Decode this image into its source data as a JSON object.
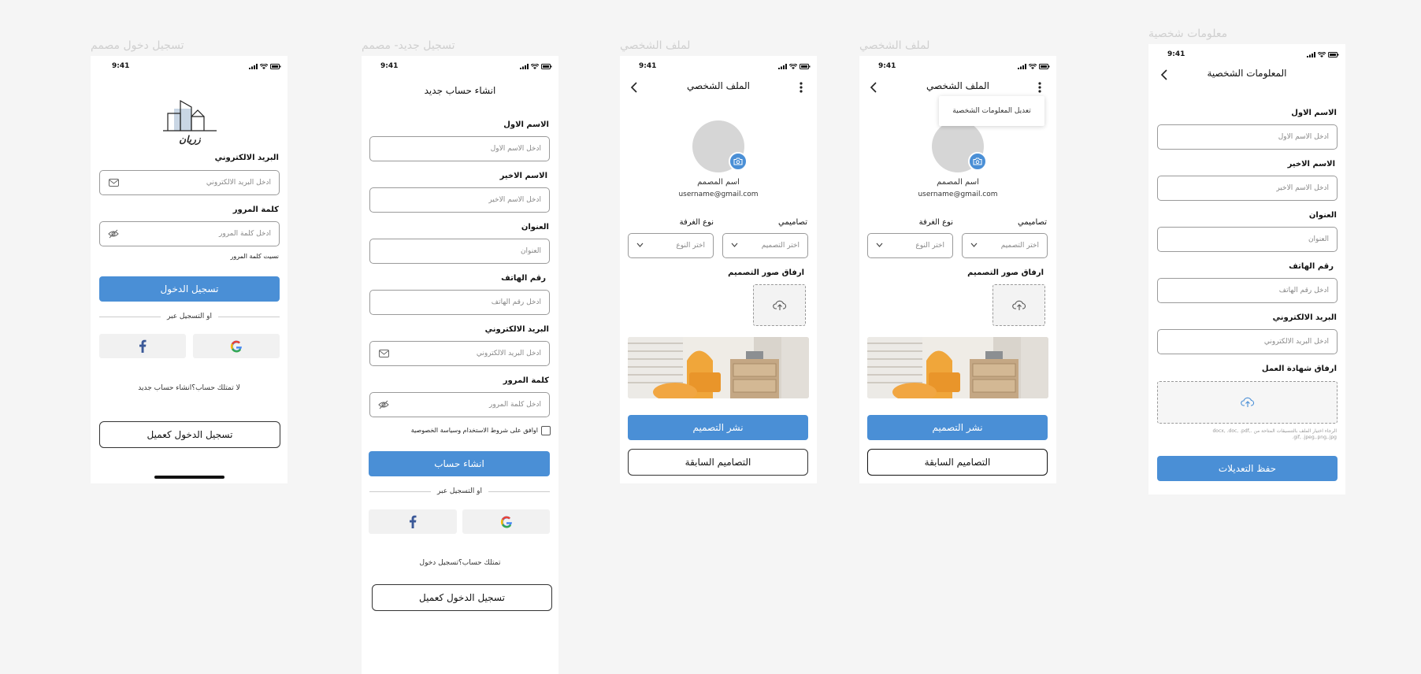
{
  "status_time": "9:41",
  "frames": {
    "login": {
      "title": "تسجيل دخول مصمم",
      "logo_text": "زريان",
      "email_label": "البريد الالكتروني",
      "email_placeholder": "ادخل البريد الالكتروني",
      "password_label": "كلمة المرور",
      "password_placeholder": "ادخل كلمة المرور",
      "forgot_password": "نسيت كلمة المرور",
      "login_button": "تسجيل الدخول",
      "or_register_with": "او التسجيل عبر",
      "no_account": "لا تمتلك حساب؟انشاء حساب جديد",
      "client_login_button": "تسجيل الدخول كعميل"
    },
    "signup": {
      "title": "تسجيل جديد- مصمم",
      "header": "انشاء حساب جديد",
      "first_name_label": "الاسم الاول",
      "first_name_placeholder": "ادخل الاسم الاول",
      "last_name_label": "الاسم الاخير",
      "last_name_placeholder": "ادخل الاسم الاخير",
      "address_label": "العنوان",
      "address_placeholder": "العنوان",
      "phone_label": "رقم الهاتف",
      "phone_placeholder": "ادخل رقم الهاتف",
      "email_label": "البريد الالكتروني",
      "email_placeholder": "ادخل البريد الالكتروني",
      "password_label": "كلمة المرور",
      "password_placeholder": "ادخل كلمة المرور",
      "terms_text": "اوافق على شروط الاستخدام وسياسة الخصوصية",
      "create_button": "انشاء حساب",
      "or_register_with": "او التسجيل عبر",
      "have_account": "تمتلك حساب؟تسجيل دخول",
      "client_login_button": "تسجيل الدخول كعميل"
    },
    "profile1": {
      "title": "لملف الشخصي",
      "header": "الملف الشخصي",
      "designer_name": "اسم المصمم",
      "email": "username@gmail.com",
      "my_designs_label": "تصاميمي",
      "my_designs_placeholder": "اختر التصميم",
      "room_type_label": "نوع الغرفة",
      "room_type_placeholder": "اختر النوع",
      "attach_label": "ارفاق صور التصميم",
      "publish_button": "نشر التصميم",
      "previous_button": "التصاميم السابقة"
    },
    "profile2": {
      "title": "لملف الشخصي",
      "header": "الملف الشخصي",
      "menu_item": "تعديل المعلومات الشخصية",
      "designer_name": "اسم المصمم",
      "email": "username@gmail.com",
      "my_designs_label": "تصاميمي",
      "my_designs_placeholder": "اختر التصميم",
      "room_type_label": "نوع الغرفة",
      "room_type_placeholder": "اختر النوع",
      "attach_label": "ارفاق صور التصميم",
      "publish_button": "نشر التصميم",
      "previous_button": "التصاميم السابقة"
    },
    "personal": {
      "title": "معلومات شخصية",
      "header": "المعلومات الشخصية",
      "first_name_label": "الاسم الاول",
      "first_name_placeholder": "ادخل الاسم الاول",
      "last_name_label": "الاسم الاخير",
      "last_name_placeholder": "ادخل الاسم الاخير",
      "address_label": "العنوان",
      "address_placeholder": "العنوان",
      "phone_label": "رقم الهاتف",
      "phone_placeholder": "ادخل رقم الهاتف",
      "email_label": "البريد الالكتروني",
      "email_placeholder": "ادخل البريد الالكتروني",
      "certificate_label": "ارفاق شهادة العمل",
      "upload_hint": "الرجاء اختيار الملف بالتنسيقات المتاحة من .docx, .doc, .pdf, .gif, .jpeg,.png,.jpg",
      "save_button": "حفظ التعديلات"
    }
  },
  "colors": {
    "primary": "#4a8fd6",
    "frame_title": "#cfcfcf",
    "background": "#f5f5f5"
  }
}
